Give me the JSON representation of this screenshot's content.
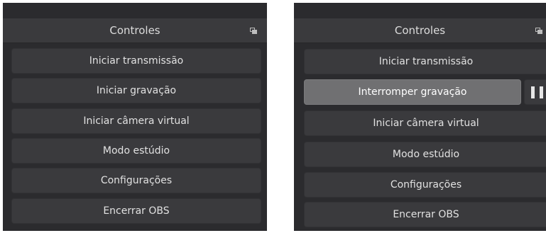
{
  "left_panel": {
    "title": "Controles",
    "buttons": [
      "Iniciar transmissão",
      "Iniciar gravação",
      "Iniciar câmera virtual",
      "Modo estúdio",
      "Configurações",
      "Encerrar OBS"
    ]
  },
  "right_panel": {
    "title": "Controles",
    "buttons": [
      "Iniciar transmissão",
      "Interromper gravação",
      "Iniciar câmera virtual",
      "Modo estúdio",
      "Configurações",
      "Encerrar OBS"
    ],
    "recording_active": true
  },
  "colors": {
    "panel_bg": "#2b2b2e",
    "button_bg": "#3a3a3d",
    "active_button_bg": "#707072",
    "text": "#e1e1e1"
  },
  "icons": {
    "dock_float": "float-icon",
    "pause": "pause-icon"
  }
}
